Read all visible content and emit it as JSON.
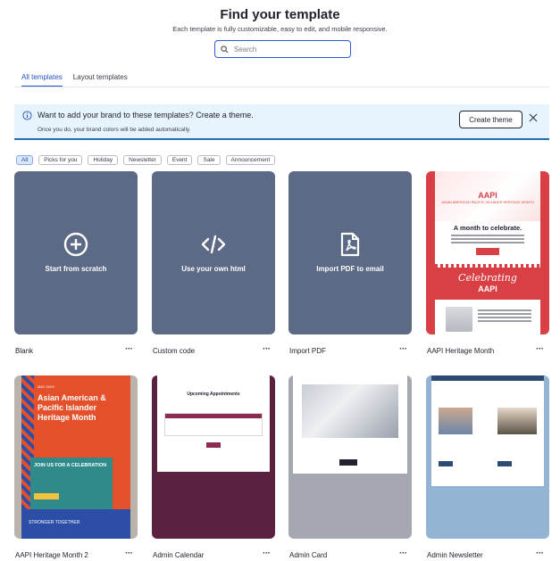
{
  "header": {
    "title": "Find your template",
    "subtitle": "Each template is fully customizable, easy to edit, and mobile responsive."
  },
  "search": {
    "placeholder": "Search"
  },
  "tabs": [
    {
      "label": "All templates",
      "active": true
    },
    {
      "label": "Layout templates",
      "active": false
    }
  ],
  "banner": {
    "message": "Want to add your brand to these templates? Create a theme.",
    "sub": "Once you do, your brand colors will be added automatically.",
    "button": "Create theme"
  },
  "filters": [
    "All",
    "Picks for you",
    "Holiday",
    "Newsletter",
    "Event",
    "Sale",
    "Announcement"
  ],
  "cards": [
    {
      "name": "Blank",
      "center_label": "Start from scratch",
      "icon": "plus-circle-icon"
    },
    {
      "name": "Custom code",
      "center_label": "Use your own html",
      "icon": "code-icon"
    },
    {
      "name": "Import PDF",
      "center_label": "Import PDF to email",
      "icon": "pdf-icon"
    },
    {
      "name": "AAPI Heritage Month"
    },
    {
      "name": "AAPI Heritage Month 2"
    },
    {
      "name": "Admin Calendar"
    },
    {
      "name": "Admin Card"
    },
    {
      "name": "Admin Newsletter"
    }
  ],
  "previews": {
    "aapi": {
      "top": "AAPI",
      "subtitle": "ASIAN AMERICAN PACIFIC ISLANDER HERITAGE MONTH",
      "headline": "A month to celebrate.",
      "celebrating": "Celebrating",
      "celebrating2": "AAPI"
    },
    "aapi2": {
      "small": "MAY 20XX",
      "heading": "Asian American & Pacific Islander Heritage Month",
      "teal": "JOIN US FOR A CELEBRATION",
      "bottom": "STRONGER TOGETHER"
    },
    "calendar": {
      "heading": "Upcoming Appointments"
    }
  },
  "more_label": "···",
  "colors": {
    "accent": "#2253c7",
    "card_slate": "#5c6a85",
    "banner_bg": "#e8f4fd"
  }
}
